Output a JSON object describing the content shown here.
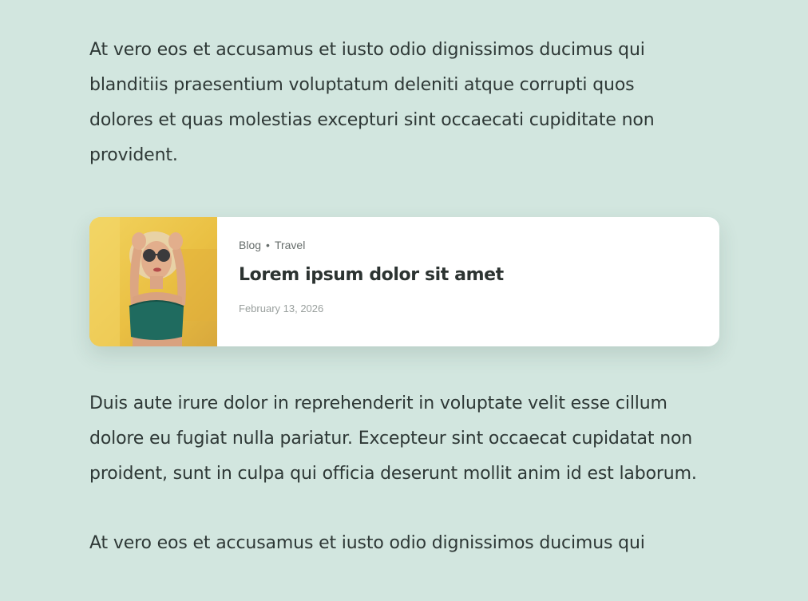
{
  "article": {
    "paragraphs": [
      "At vero eos et accusamus et iusto odio dignissimos ducimus qui blanditiis praesentium voluptatum deleniti atque corrupti quos dolores et quas molestias excepturi sint occaecati cupiditate non provident.",
      "Duis aute irure dolor in reprehenderit in voluptate velit esse cillum dolore eu fugiat nulla pariatur. Excepteur sint occaecat cupidatat non proident, sunt in culpa qui officia deserunt mollit anim id est laborum.",
      "At vero eos et accusamus et iusto odio dignissimos ducimus qui"
    ]
  },
  "card": {
    "categories": [
      "Blog",
      "Travel"
    ],
    "separator": "•",
    "title": "Lorem ipsum dolor sit amet",
    "date": "February 13, 2026",
    "image_icon": "woman-with-sunglasses-photo"
  },
  "colors": {
    "background": "#d2e6df",
    "text": "#2e3836",
    "card_background": "#ffffff",
    "thumbnail_background": "#e9bf3d"
  }
}
